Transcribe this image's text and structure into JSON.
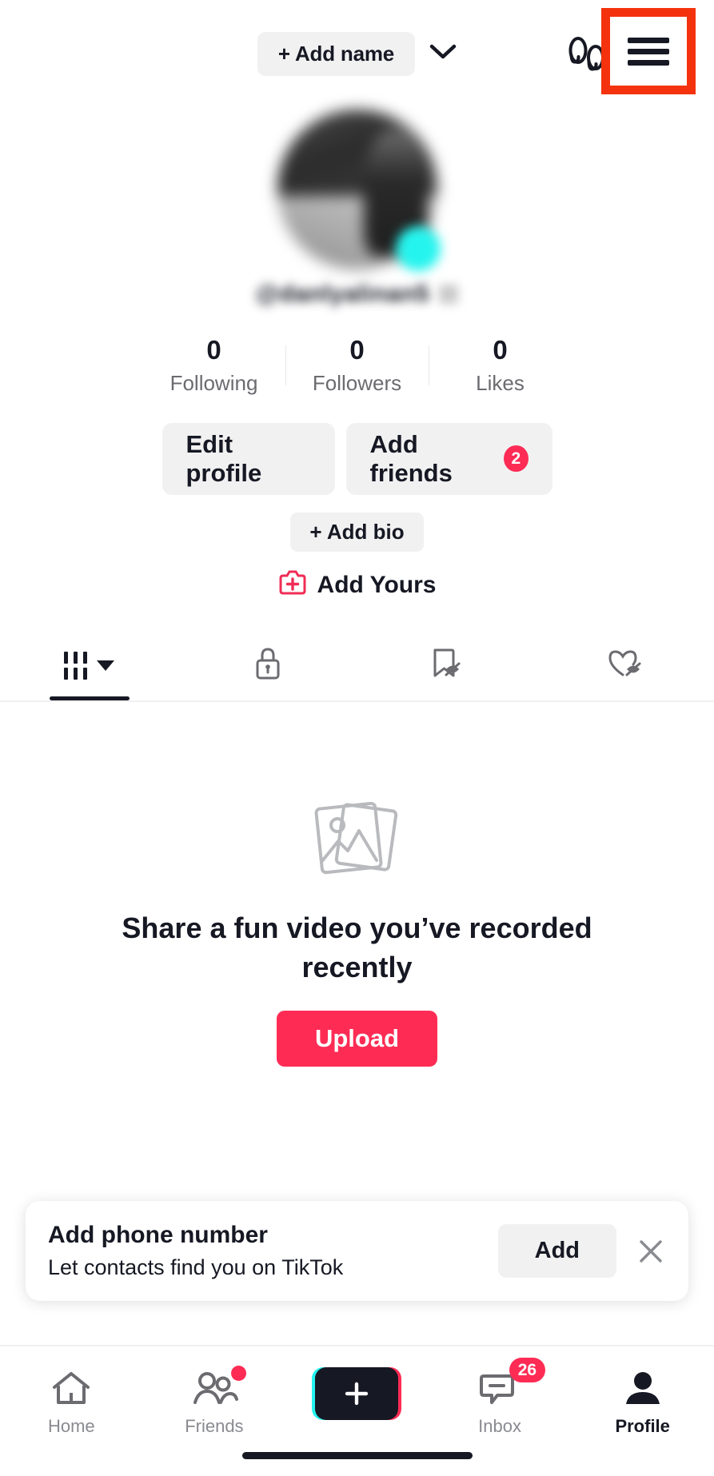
{
  "topbar": {
    "add_name_label": "+ Add name",
    "chevron_icon": "chevron-down-icon",
    "footsteps_icon": "footsteps-icon",
    "menu_icon": "hamburger-menu-icon",
    "highlight_color": "#f4330e"
  },
  "profile": {
    "avatar_icon": "avatar",
    "avatar_badge_color": "#25f4ee",
    "username": "@danlyalinan5",
    "stats": [
      {
        "count": "0",
        "label": "Following"
      },
      {
        "count": "0",
        "label": "Followers"
      },
      {
        "count": "0",
        "label": "Likes"
      }
    ],
    "edit_profile_label": "Edit profile",
    "add_friends_label": "Add friends",
    "add_friends_badge": "2",
    "add_bio_label": "+ Add bio",
    "add_yours_label": "Add Yours",
    "add_yours_icon": "add-yours-icon"
  },
  "tabs": [
    {
      "name": "videos-tab",
      "icon": "grid-icon",
      "active": true,
      "has_caret": true
    },
    {
      "name": "private-tab",
      "icon": "lock-icon",
      "active": false,
      "has_caret": false
    },
    {
      "name": "saved-tab",
      "icon": "bookmark-hidden-icon",
      "active": false,
      "has_caret": false
    },
    {
      "name": "liked-tab",
      "icon": "heart-hidden-icon",
      "active": false,
      "has_caret": false
    }
  ],
  "empty_state": {
    "image_icon": "photo-stack-icon",
    "title": "Share a fun video you’ve recorded recently",
    "upload_label": "Upload",
    "upload_color": "#fe2c55"
  },
  "banner": {
    "title": "Add phone number",
    "subtitle": "Let contacts find you on TikTok",
    "action_label": "Add",
    "close_icon": "close-icon"
  },
  "bottomnav": [
    {
      "label": "Home",
      "icon": "home-icon",
      "active": false,
      "dot": false,
      "badge": ""
    },
    {
      "label": "Friends",
      "icon": "friends-icon",
      "active": false,
      "dot": true,
      "badge": ""
    },
    {
      "label": "",
      "icon": "create-plus-icon",
      "active": false,
      "dot": false,
      "badge": ""
    },
    {
      "label": "Inbox",
      "icon": "inbox-icon",
      "active": false,
      "dot": false,
      "badge": "26"
    },
    {
      "label": "Profile",
      "icon": "person-icon",
      "active": true,
      "dot": false,
      "badge": ""
    }
  ]
}
